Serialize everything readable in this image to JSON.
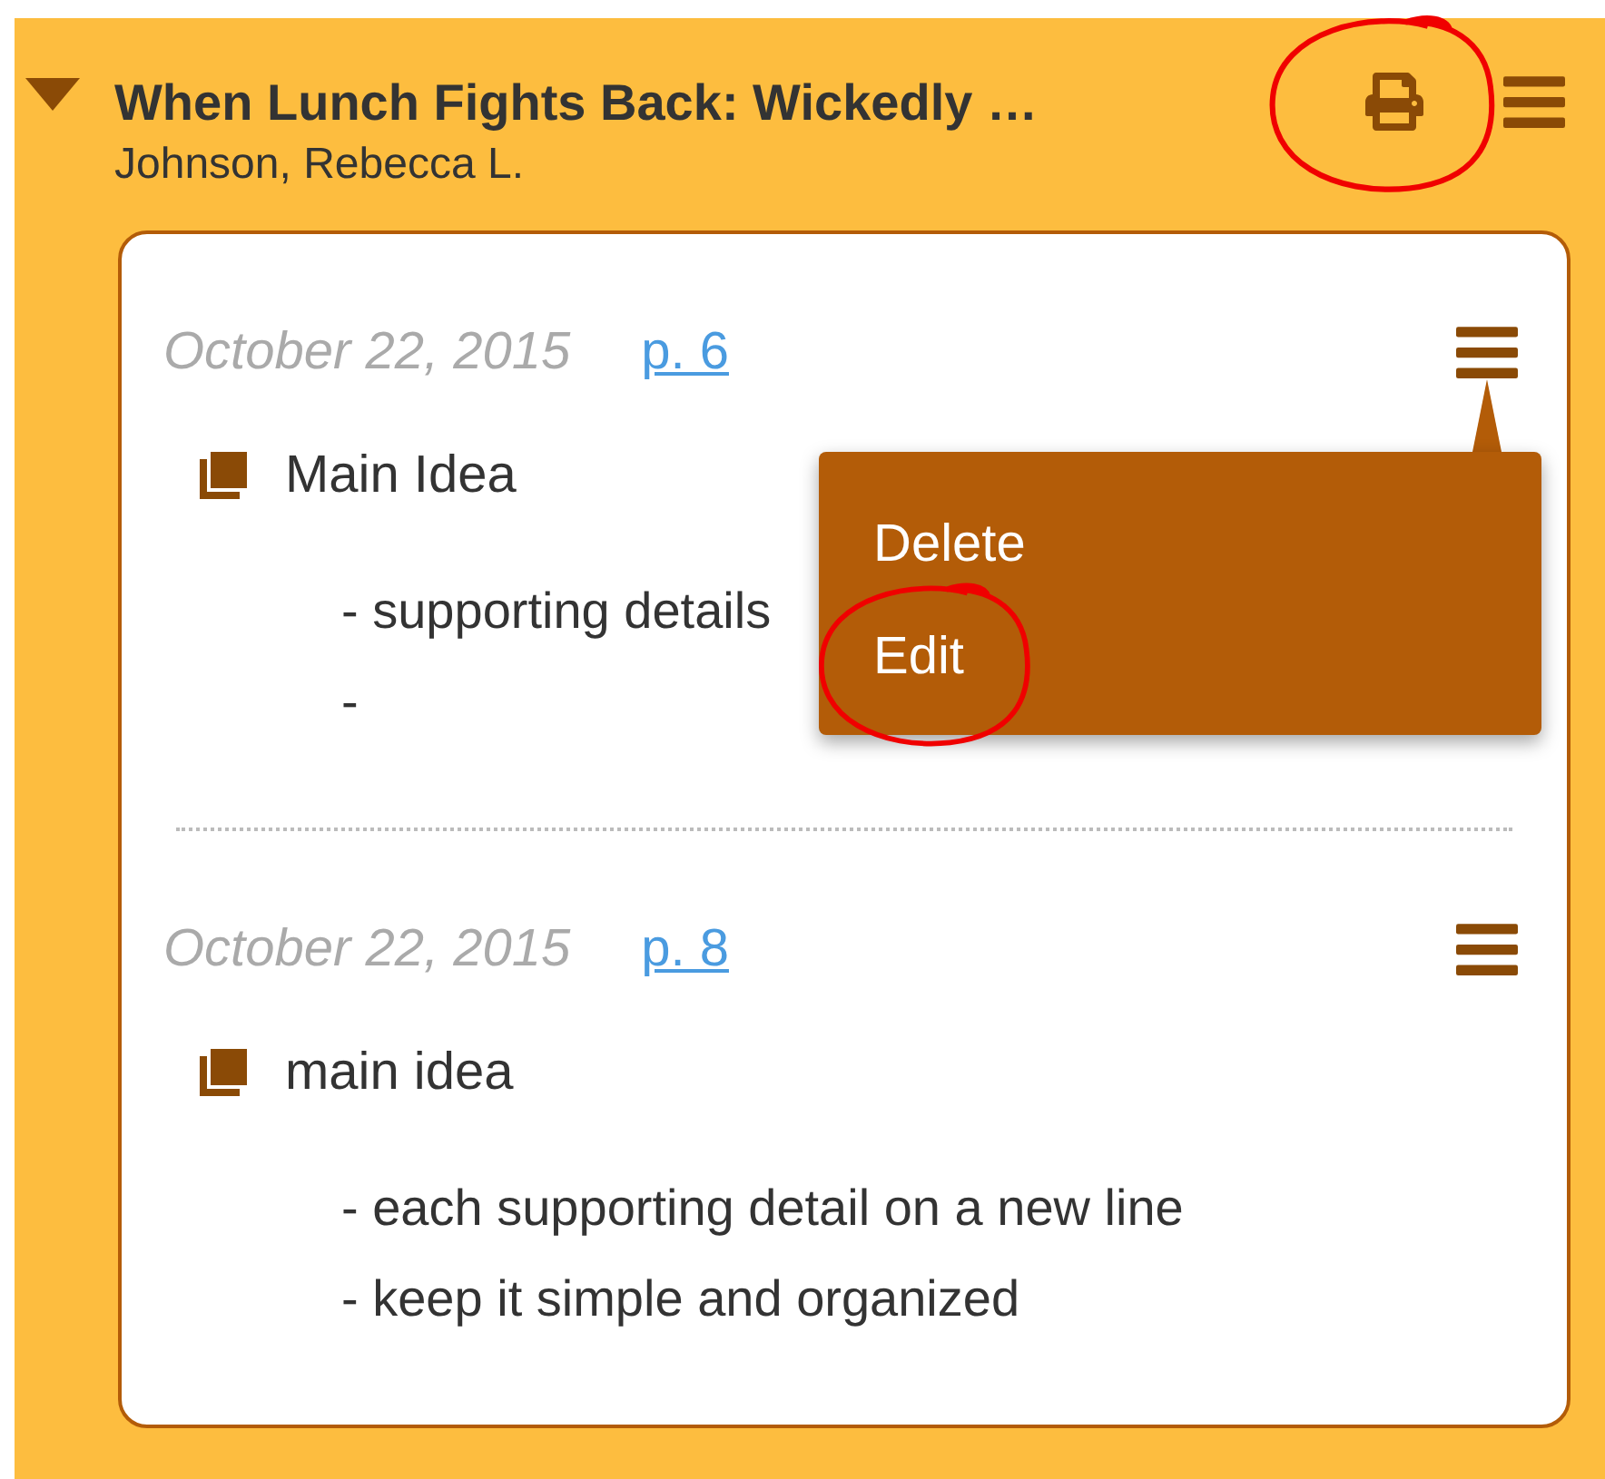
{
  "book": {
    "expanded": true,
    "title": "When Lunch Fights Back: Wickedly …",
    "author": "Johnson, Rebecca L.",
    "print_circled": true
  },
  "notes": [
    {
      "date": "October 22, 2015",
      "page": "p. 6",
      "main_idea": "Main Idea",
      "details": [
        "- supporting details",
        "-"
      ],
      "menu": {
        "items": [
          {
            "label": "Delete",
            "circled": false
          },
          {
            "label": "Edit",
            "circled": true
          }
        ]
      }
    },
    {
      "date": "October 22, 2015",
      "page": "p. 8",
      "main_idea": "main idea",
      "details": [
        "- each supporting detail on a new line",
        "- keep it simple and organized"
      ]
    }
  ]
}
